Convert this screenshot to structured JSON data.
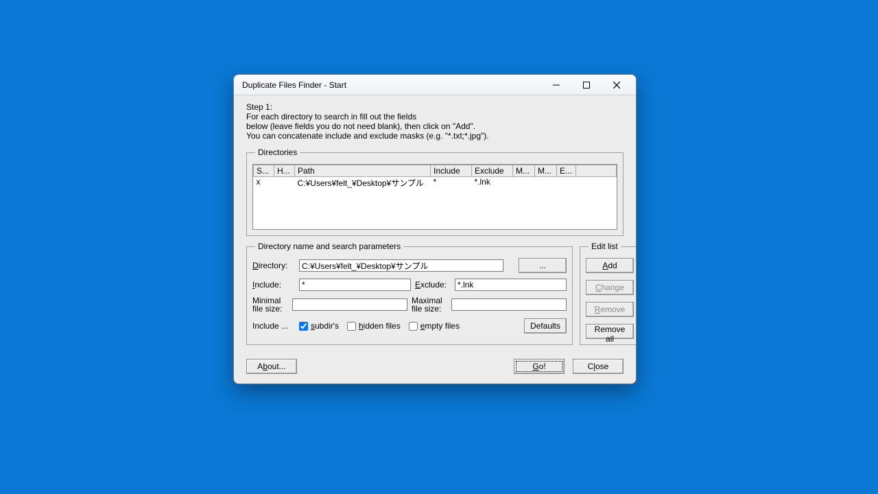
{
  "window": {
    "title": "Duplicate Files Finder - Start"
  },
  "instructions": {
    "step": "Step 1:",
    "line1": "For each directory to search in fill out the fields",
    "line2": "below (leave fields you do not need blank), then click on \"Add\".",
    "line3": "You can concatenate include and exclude masks (e.g. \"*.txt;*.jpg\")."
  },
  "directories": {
    "legend": "Directories",
    "columns": {
      "s": "S...",
      "h": "H...",
      "path": "Path",
      "include": "Include",
      "exclude": "Exclude",
      "m1": "M...",
      "m2": "M...",
      "e": "E..."
    },
    "rows": [
      {
        "s": "x",
        "h": "",
        "path": "C:¥Users¥felt_¥Desktop¥サンプル",
        "include": "*",
        "exclude": "*.lnk",
        "m1": "",
        "m2": "",
        "e": ""
      }
    ]
  },
  "params": {
    "legend": "Directory name and search parameters",
    "directory_label": "Directory:",
    "directory_value": "C:¥Users¥felt_¥Desktop¥サンプル",
    "browse_label": "...",
    "include_label": "Include:",
    "include_value": "*",
    "exclude_label": "Exclude:",
    "exclude_value": "*.lnk",
    "min_label_a": "Minimal",
    "min_label_b": "file size:",
    "min_value": "",
    "max_label_a": "Maximal",
    "max_label_b": "file size:",
    "max_value": "",
    "include_opts": "Include ...",
    "subdirs": "subdir's",
    "hidden": "hidden files",
    "empty": "empty files",
    "subdirs_checked": true,
    "hidden_checked": false,
    "empty_checked": false,
    "defaults": "Defaults"
  },
  "editlist": {
    "legend": "Edit list",
    "add": "Add",
    "change": "Change",
    "remove": "Remove",
    "remove_all": "Remove all"
  },
  "footer": {
    "about": "About...",
    "go": "Go!",
    "close": "Close"
  }
}
